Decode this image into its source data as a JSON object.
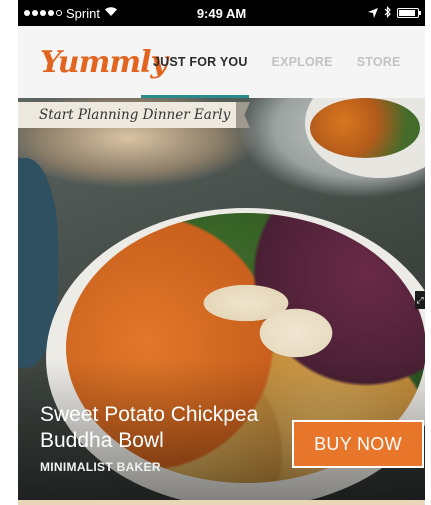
{
  "status_bar": {
    "carrier": "Sprint",
    "time": "9:49 AM",
    "signal_dots_filled": 4,
    "signal_dots_total": 5,
    "battery_level": 0.9
  },
  "nav": {
    "logo": "Yummly",
    "tabs": [
      {
        "label": "JUST FOR YOU",
        "active": true
      },
      {
        "label": "EXPLORE",
        "active": false
      },
      {
        "label": "STORE",
        "active": false
      }
    ]
  },
  "hero": {
    "banner": "Start Planning Dinner Early",
    "title_line1": "Sweet Potato Chickpea",
    "title_line2": "Buddha Bowl",
    "source": "MINIMALIST BAKER",
    "buy_label": "BUY NOW"
  },
  "colors": {
    "brand_orange": "#e2651f",
    "buy_button": "#e8762a",
    "active_tab_underline": "#2a8b8d"
  },
  "icons": {
    "wifi": "wifi-icon",
    "location": "location-arrow-icon",
    "bluetooth": "bluetooth-icon",
    "battery": "battery-icon",
    "expand": "expand-icon"
  }
}
